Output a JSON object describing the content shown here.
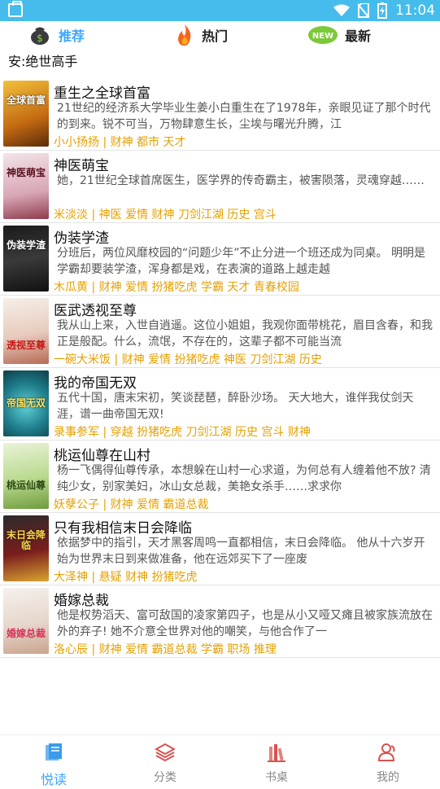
{
  "status_bar": {
    "time": "11:04"
  },
  "tabs": [
    {
      "label": "推荐",
      "icon": "money-bag-icon",
      "active": true
    },
    {
      "label": "热门",
      "icon": "flame-icon",
      "active": false
    },
    {
      "label": "最新",
      "icon": "new-badge-icon",
      "active": false
    }
  ],
  "announcement": "安:绝世高手",
  "books": [
    {
      "title": "重生之全球首富",
      "desc": "21世纪的经济系大学毕业生姜小白重生在了1978年，亲眼见证了那个时代的到来。锐不可当，万物肆意生长，尘埃与曙光升腾，江",
      "meta": "小小扬扬 | 财神 都市 天才",
      "cover_text": "全球首富"
    },
    {
      "title": "神医萌宝",
      "desc": "她，21世纪全球首席医生，医学界的传奇霸主，被害陨落，灵魂穿越……",
      "meta": "米淡淡 | 神医 爱情 财神 刀剑江湖 历史 宫斗",
      "cover_text": "神医萌宝"
    },
    {
      "title": "伪装学渣",
      "desc": "分班后，两位风靡校园的“问题少年”不止分进一个班还成为同桌。    明明是学霸却要装学渣，浑身都是戏，在表演的道路上越走越",
      "meta": "木瓜黄 | 财神 爱情 扮猪吃虎 学霸 天才 青春校园",
      "cover_text": "伪装学渣"
    },
    {
      "title": "医武透视至尊",
      "desc": "我从山上来，入世自逍遥。这位小姐姐，我观你面带桃花，眉目含春，和我正是般配。什么，流氓，不存在的，这辈子都不可能当流",
      "meta": "一碗大米饭 | 财神 爱情 扮猪吃虎 神医 刀剑江湖 历史",
      "cover_text": "透视至尊"
    },
    {
      "title": "我的帝国无双",
      "desc": "五代十国，唐末宋初，笑谈琵琶，醉卧沙场。    天大地大，谁伴我仗剑天涯，谱一曲帝国无双!",
      "meta": "录事参军 | 穿越 扮猪吃虎 刀剑江湖 历史 宫斗 财神",
      "cover_text": "帝国无双"
    },
    {
      "title": "桃运仙尊在山村",
      "desc": "杨一飞偶得仙尊传承，本想躲在山村一心求道，为何总有人缠着他不放? 清纯少女，别家美妇，冰山女总裁，美艳女杀手……求求你",
      "meta": "妖孽公子 | 财神 爱情 霸道总裁",
      "cover_text": "桃运仙尊"
    },
    {
      "title": "只有我相信末日会降临",
      "desc": "依据梦中的指引，天才黑客周鸣一直都相信，末日会降临。    他从十六岁开始为世界末日到来做准备，他在远郊买下了一座废",
      "meta": "大泽神 | 悬疑 财神 扮猪吃虎",
      "cover_text": "末日会降临"
    },
    {
      "title": "婚嫁总裁",
      "desc": "他是权势滔天、富可敌国的凌家第四子，也是从小又哑又瘫且被家族流放在外的弃子!    她不介意全世界对他的嘲笑，与他合作了一",
      "meta": "洛心辰 | 财神 爱情 霸道总裁 学霸 职场 推理",
      "cover_text": "婚嫁总裁"
    }
  ],
  "bottom_nav": [
    {
      "label": "悦读",
      "icon": "book-stack-icon",
      "active": true
    },
    {
      "label": "分类",
      "icon": "layers-icon",
      "active": false
    },
    {
      "label": "书桌",
      "icon": "bookshelf-icon",
      "active": false
    },
    {
      "label": "我的",
      "icon": "user-icon",
      "active": false
    }
  ],
  "colors": {
    "status_bar": "#46bcec",
    "accent": "#3ba6ff",
    "tag": "#e5a000"
  }
}
